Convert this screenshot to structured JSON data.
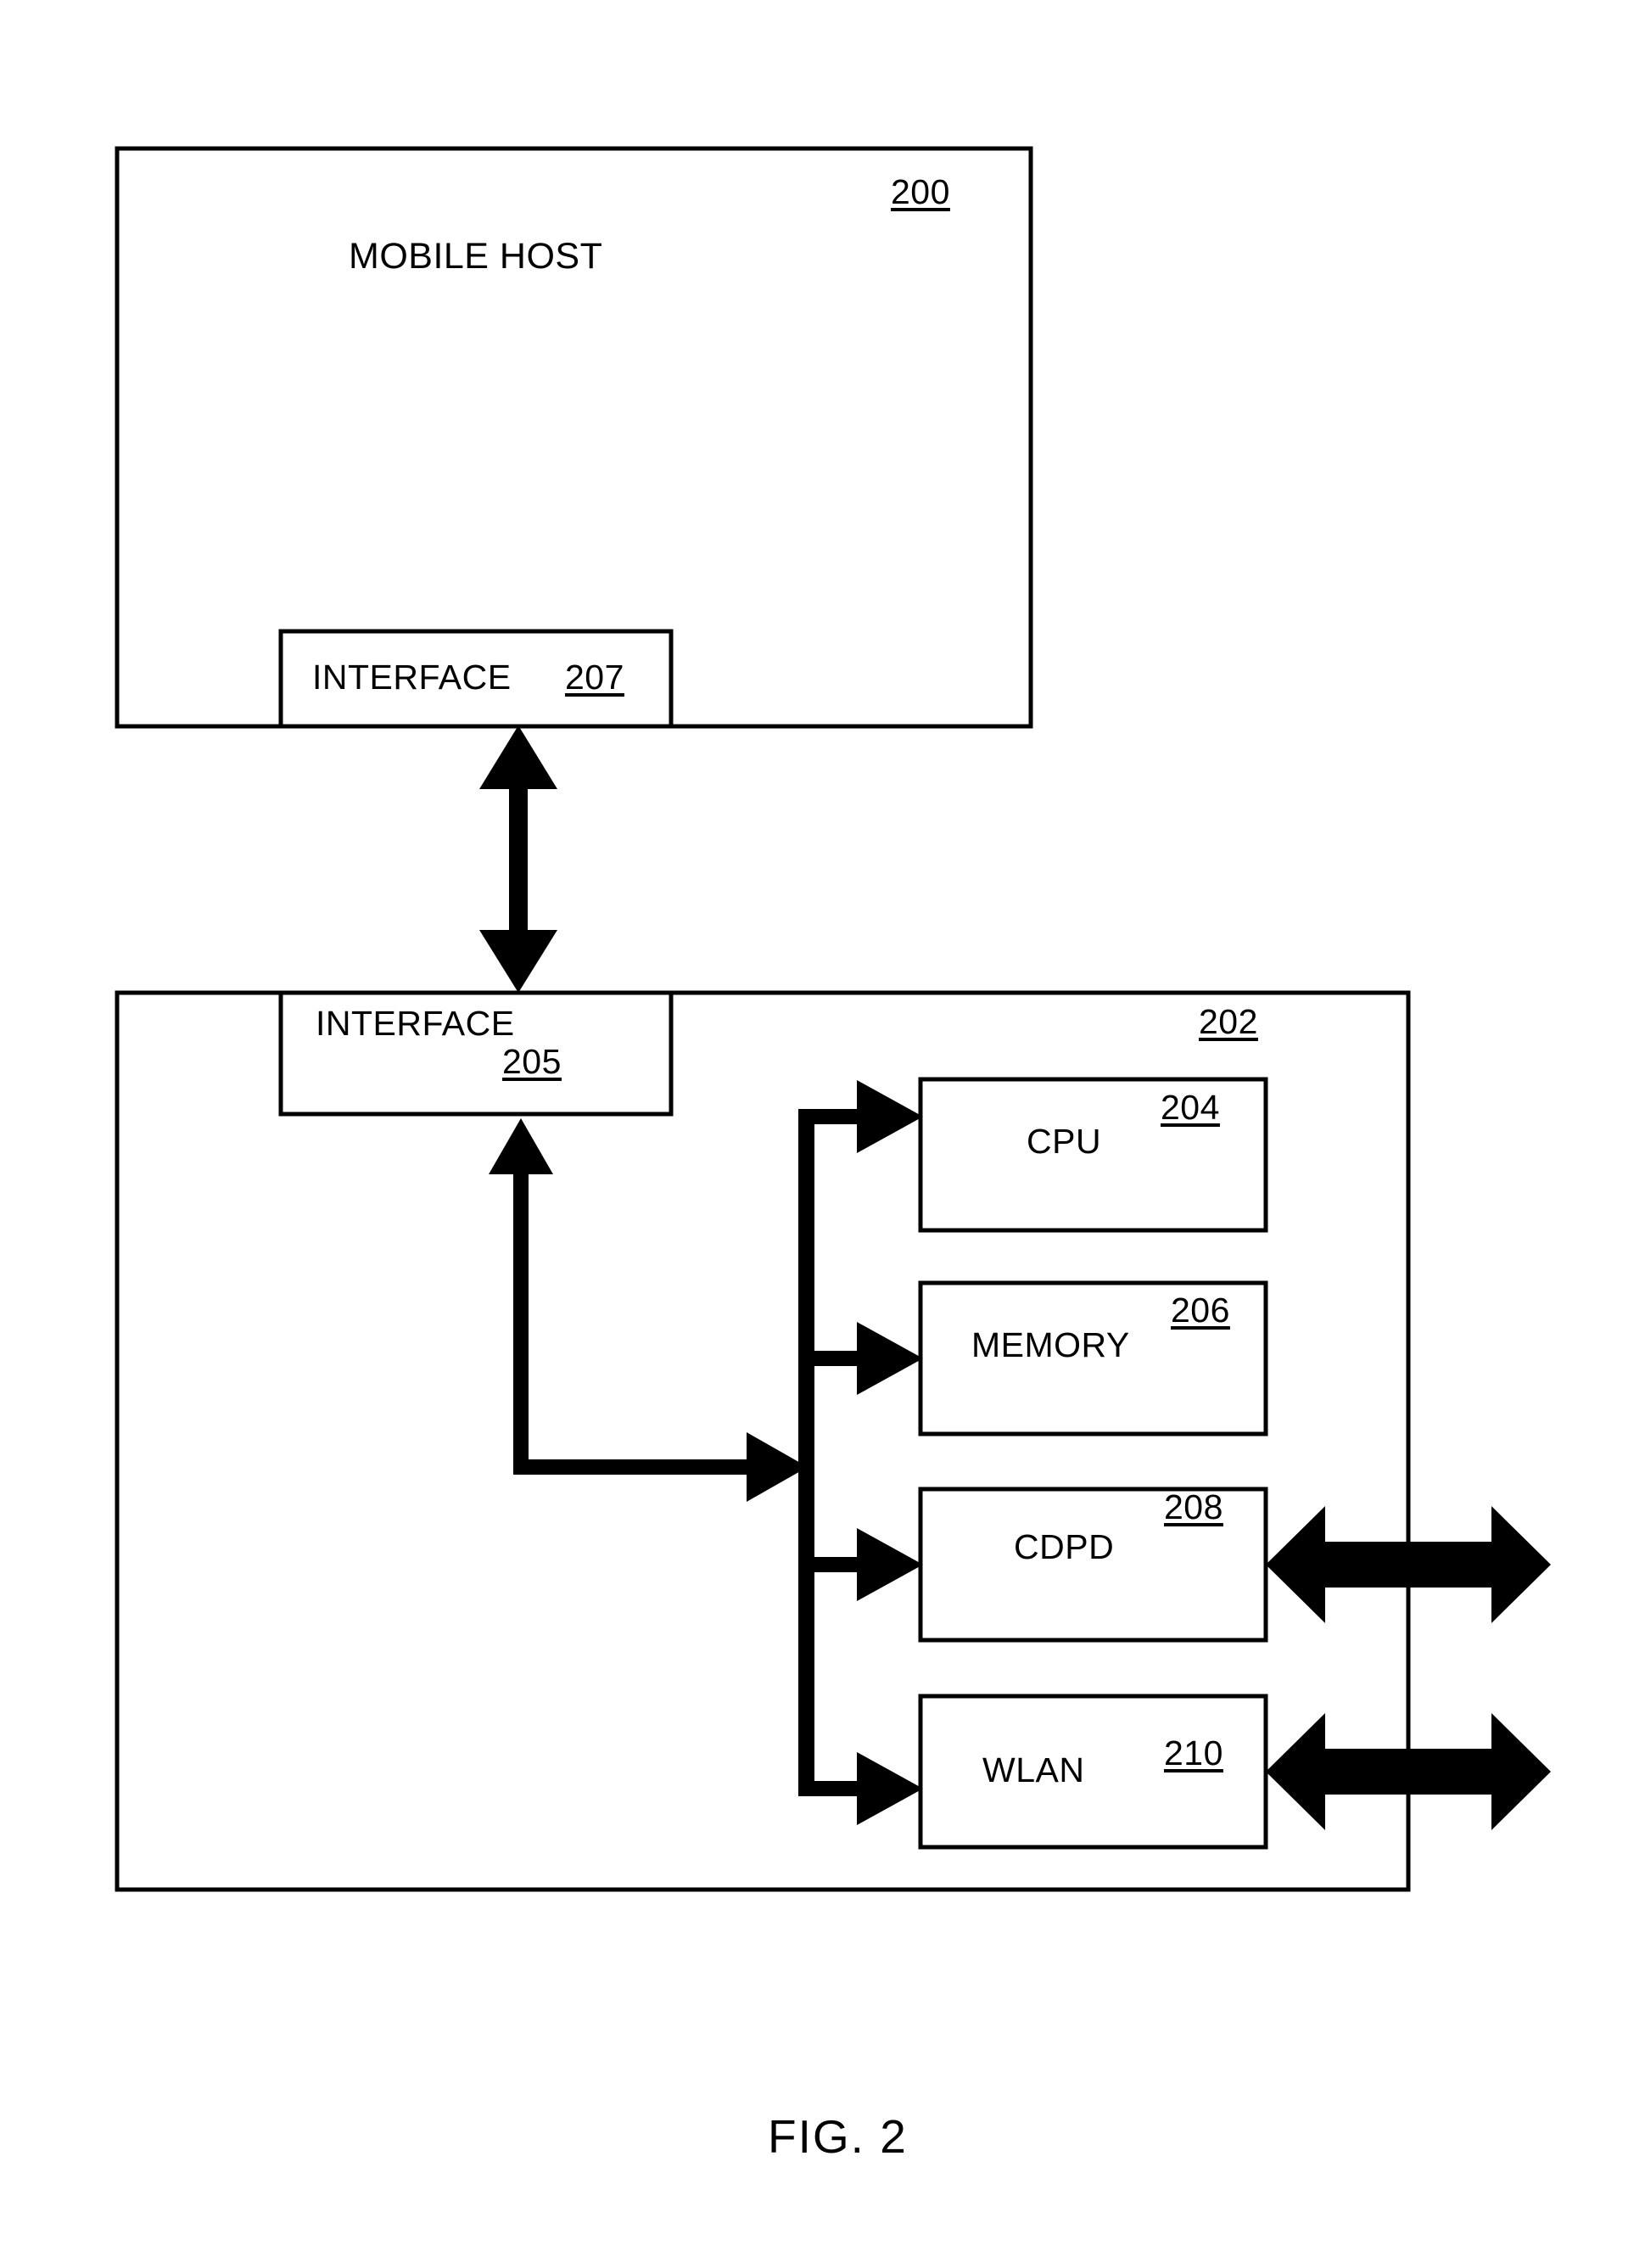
{
  "figure": {
    "caption": "FIG. 2",
    "type": "patent-block-diagram"
  },
  "blocks": {
    "mobile_host": {
      "label": "MOBILE HOST",
      "reference_numeral": "200",
      "interface": {
        "label": "INTERFACE",
        "reference_numeral": "207"
      }
    },
    "device": {
      "reference_numeral": "202",
      "interface": {
        "label": "INTERFACE",
        "reference_numeral": "205"
      },
      "components": [
        {
          "label": "CPU",
          "reference_numeral": "204"
        },
        {
          "label": "MEMORY",
          "reference_numeral": "206"
        },
        {
          "label": "CDPD",
          "reference_numeral": "208"
        },
        {
          "label": "WLAN",
          "reference_numeral": "210"
        }
      ]
    }
  },
  "connectors": {
    "host_to_device": "bidirectional-vertical-arrow",
    "interface_to_bus": "bus-feed-arrow",
    "bus_to_components": "bus-branch-arrows",
    "cdpd_external": "bidirectional-horizontal-arrow",
    "wlan_external": "bidirectional-horizontal-arrow"
  },
  "colors": {
    "stroke": "#000000",
    "background": "#ffffff"
  }
}
